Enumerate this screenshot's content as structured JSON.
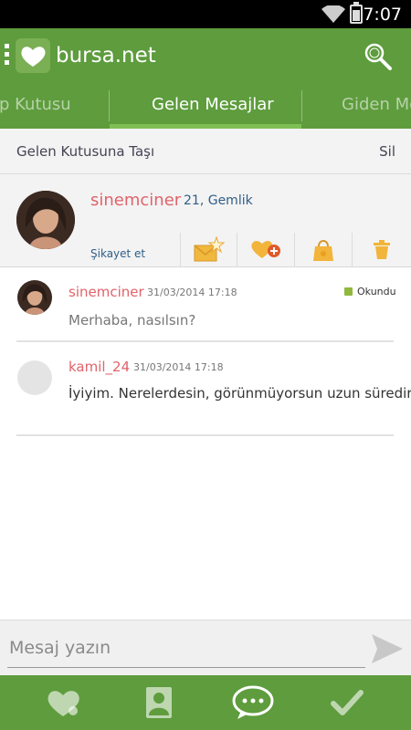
{
  "status_bar": {
    "time": "7:07"
  },
  "action_bar": {
    "title": "bursa.net"
  },
  "tabs": [
    {
      "label": "p Kutusu",
      "active": false
    },
    {
      "label": "Gelen Mesajlar",
      "active": true
    },
    {
      "label": "Giden Me",
      "active": false
    }
  ],
  "actions": {
    "move_label": "Gelen Kutusuna Taşı",
    "delete_label": "Sil"
  },
  "profile": {
    "username": "sinemciner",
    "age_location": "21, Gemlik",
    "report_label": "Şikayet et"
  },
  "messages": [
    {
      "user": "sinemciner",
      "date": "31/03/2014 17:18",
      "text": "Merhaba, nasılsın?",
      "status": "Okundu"
    },
    {
      "user": "kamil_24",
      "date": "31/03/2014 17:18",
      "text": "İyiyim. Nerelerdesin, görünmüyorsun uzun süredir?"
    }
  ],
  "compose": {
    "placeholder": "Mesaj yazın"
  },
  "colors": {
    "brand_green": "#5e9c3d",
    "username_red": "#e0636b",
    "link_blue": "#2f5e87"
  },
  "icons": [
    "menu-icon",
    "logo-heart-icon",
    "search-icon",
    "new-message-icon",
    "favorite-add-icon",
    "gift-icon",
    "trash-icon",
    "send-icon",
    "heart-icon",
    "profile-icon",
    "chat-icon",
    "check-icon"
  ]
}
